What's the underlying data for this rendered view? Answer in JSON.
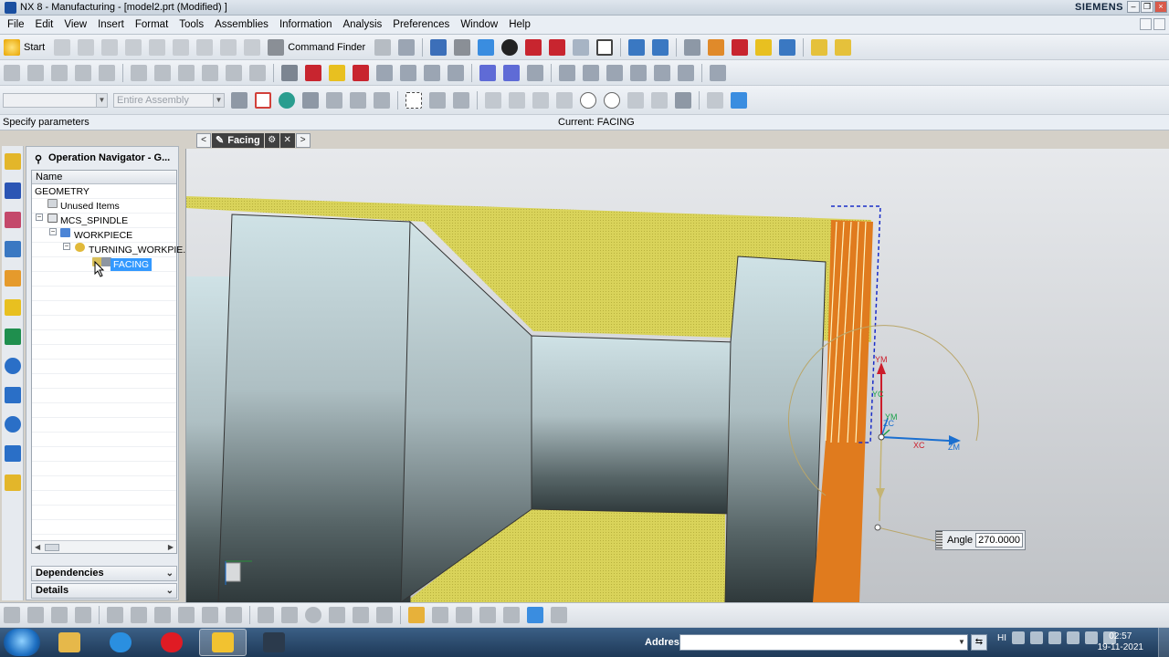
{
  "window": {
    "title": "NX 8 - Manufacturing - [model2.prt (Modified) ]",
    "brand": "SIEMENS"
  },
  "menu": [
    "File",
    "Edit",
    "View",
    "Insert",
    "Format",
    "Tools",
    "Assemblies",
    "Information",
    "Analysis",
    "Preferences",
    "Window",
    "Help"
  ],
  "toolbar": {
    "start_label": "Start",
    "command_finder_label": "Command Finder",
    "selection_filter_value": "",
    "scope_value": "Entire Assembly"
  },
  "status": {
    "prompt": "Specify parameters",
    "current": "Current: FACING"
  },
  "operation_tab": {
    "label": "Facing"
  },
  "navigator": {
    "title": "Operation Navigator - G...",
    "column_name": "Name",
    "rows": [
      {
        "label": "GEOMETRY"
      },
      {
        "label": "Unused Items"
      },
      {
        "label": "MCS_SPINDLE"
      },
      {
        "label": "WORKPIECE"
      },
      {
        "label": "TURNING_WORKPIE..."
      },
      {
        "label": "FACING"
      }
    ],
    "sections": {
      "dependencies": "Dependencies",
      "details": "Details"
    }
  },
  "graphics": {
    "axis_labels": {
      "ym": "YM",
      "yc": "YC",
      "zc": "ZC",
      "xc": "XC",
      "zm": "ZM"
    },
    "angle_label": "Angle",
    "angle_value": "270.0000"
  },
  "taskbar": {
    "address_label": "Address",
    "address_value": "",
    "tray_text": "HI",
    "time": "02:57",
    "date": "19-11-2021"
  }
}
